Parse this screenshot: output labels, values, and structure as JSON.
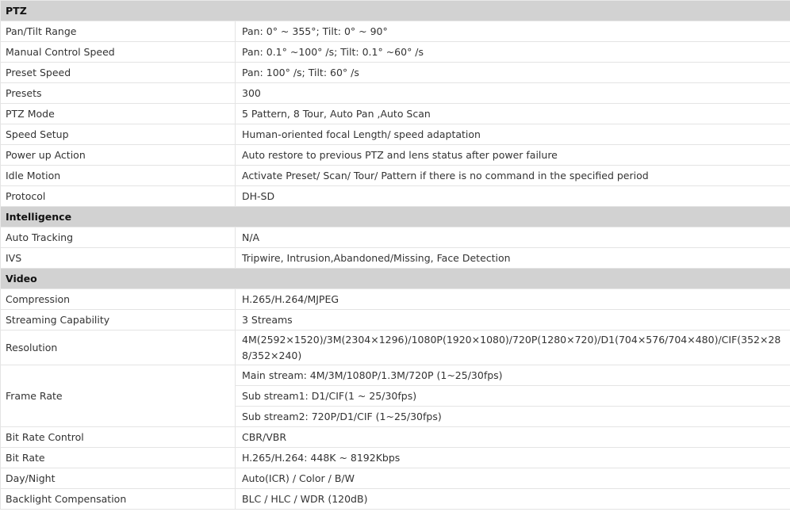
{
  "sections": [
    {
      "title": "PTZ",
      "rows": [
        {
          "label": "Pan/Tilt Range",
          "value": "Pan: 0° ~ 355°; Tilt: 0° ~ 90°"
        },
        {
          "label": "Manual Control Speed",
          "value": "Pan: 0.1° ~100° /s; Tilt: 0.1° ~60° /s"
        },
        {
          "label": "Preset Speed",
          "value": "Pan: 100° /s; Tilt: 60° /s"
        },
        {
          "label": "Presets",
          "value": "300"
        },
        {
          "label": "PTZ Mode",
          "value": "5 Pattern, 8 Tour, Auto Pan ,Auto Scan"
        },
        {
          "label": "Speed Setup",
          "value": "Human-oriented focal Length/ speed adaptation"
        },
        {
          "label": "Power up Action",
          "value": "Auto restore to previous PTZ and lens status after power failure"
        },
        {
          "label": "Idle Motion",
          "value": "Activate Preset/ Scan/ Tour/ Pattern if there is no command in the specified period"
        },
        {
          "label": "Protocol",
          "value": "DH-SD"
        }
      ]
    },
    {
      "title": "Intelligence",
      "rows": [
        {
          "label": "Auto Tracking",
          "value": "N/A"
        },
        {
          "label": "IVS",
          "value": "Tripwire, Intrusion,Abandoned/Missing, Face Detection"
        }
      ]
    },
    {
      "title": "Video",
      "rows": [
        {
          "label": "Compression",
          "value": "H.265/H.264/MJPEG"
        },
        {
          "label": "Streaming Capability",
          "value": "3 Streams"
        },
        {
          "label": "Resolution",
          "value": "4M(2592×1520)/3M(2304×1296)/1080P(1920×1080)/720P(1280×720)/D1(704×576/704×480)/CIF(352×288/352×240)"
        },
        {
          "label": "Frame Rate",
          "values": [
            "Main stream: 4M/3M/1080P/1.3M/720P (1~25/30fps)",
            "Sub stream1: D1/CIF(1 ~ 25/30fps)",
            "Sub stream2: 720P/D1/CIF (1~25/30fps)"
          ]
        },
        {
          "label": "Bit Rate Control",
          "value": "CBR/VBR"
        },
        {
          "label": "Bit Rate",
          "value": "H.265/H.264: 448K ~ 8192Kbps"
        },
        {
          "label": "Day/Night",
          "value": "Auto(ICR) / Color / B/W"
        },
        {
          "label": "Backlight Compensation",
          "value": "BLC / HLC / WDR (120dB)"
        }
      ]
    }
  ]
}
